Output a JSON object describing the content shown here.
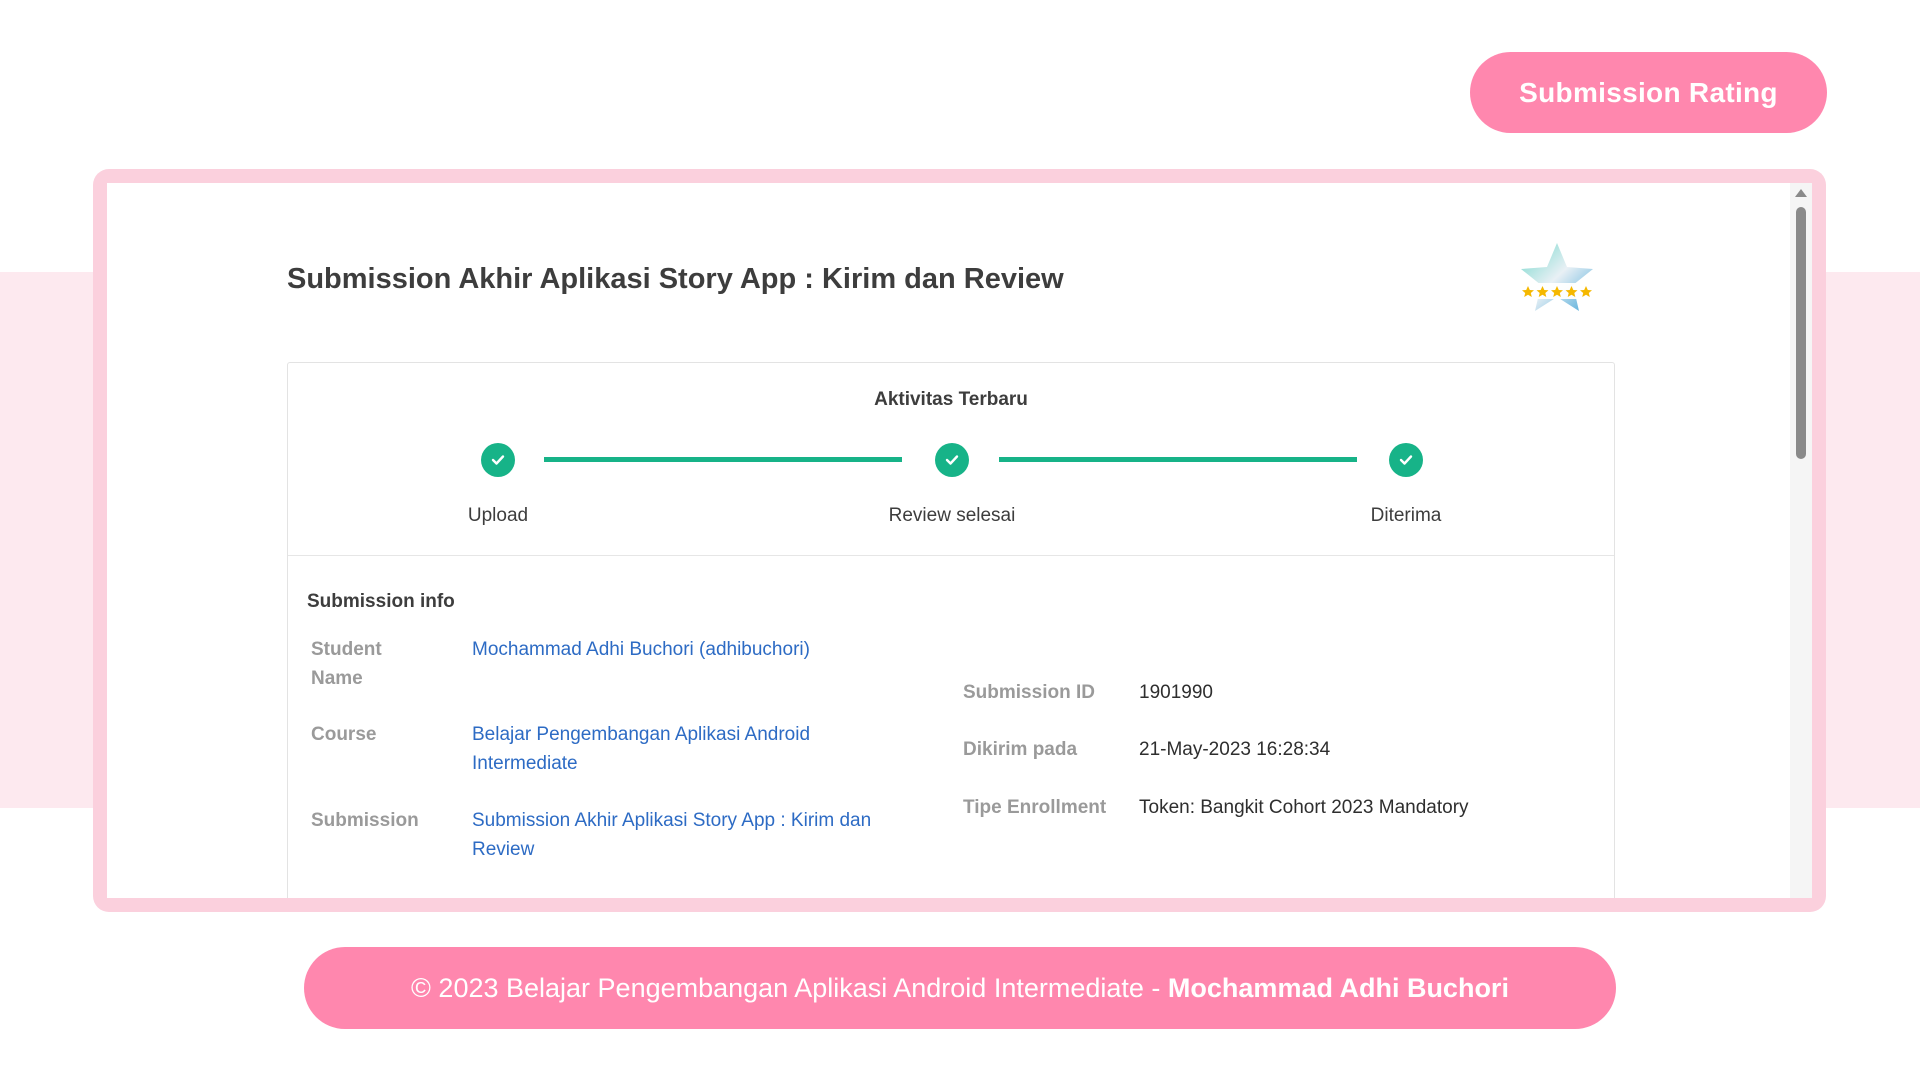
{
  "colors": {
    "accent_pink": "#ff87ae",
    "frame_pink": "#fbd0dd",
    "band_pink": "#fde9ef",
    "success_green": "#17b388",
    "link_blue": "#2d6bc4"
  },
  "header": {
    "rating_label": "Submission Rating"
  },
  "page": {
    "title": "Submission Akhir Aplikasi Story App : Kirim dan Review",
    "badge_icon": "five-star-rating-icon"
  },
  "activity": {
    "title": "Aktivitas Terbaru",
    "steps": [
      {
        "label": "Upload",
        "status": "done",
        "icon": "check-icon"
      },
      {
        "label": "Review selesai",
        "status": "done",
        "icon": "check-icon"
      },
      {
        "label": "Diterima",
        "status": "done",
        "icon": "check-icon"
      }
    ]
  },
  "info": {
    "title": "Submission info",
    "student_name_label": "Student Name",
    "student_name_value": "Mochammad Adhi Buchori (adhibuchori)",
    "course_label": "Course",
    "course_value": "Belajar Pengembangan Aplikasi Android Intermediate",
    "submission_label": "Submission",
    "submission_value": "Submission Akhir Aplikasi Story App : Kirim dan Review",
    "submission_id_label": "Submission ID",
    "submission_id_value": "1901990",
    "sent_at_label": "Dikirim pada",
    "sent_at_value": "21-May-2023 16:28:34",
    "enrollment_label": "Tipe Enrollment",
    "enrollment_value": "Token: Bangkit Cohort 2023 Mandatory"
  },
  "footer": {
    "copyright": "© 2023 Belajar Pengembangan Aplikasi Android Intermediate -",
    "author": "Mochammad Adhi Buchori"
  }
}
